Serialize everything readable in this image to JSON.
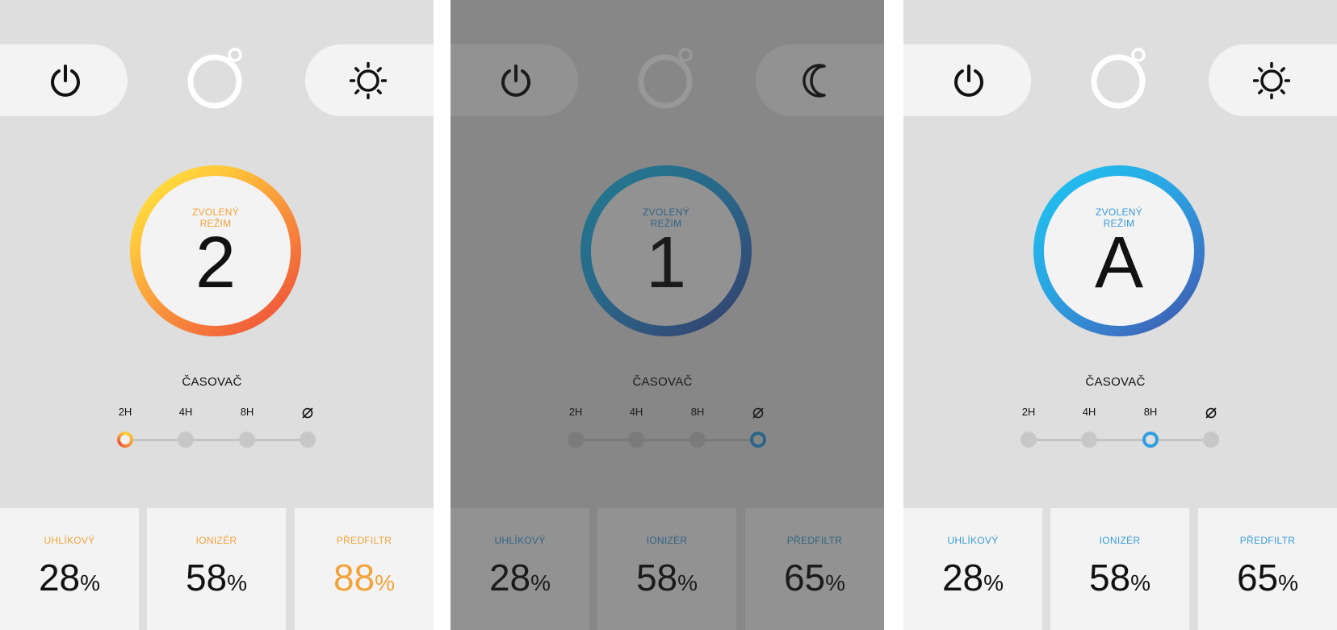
{
  "colors": {
    "warm_accent": "#f2a33a",
    "cool_accent": "#3a9bd9",
    "panel_bg": "#dedede",
    "card_bg": "#f3f3f3"
  },
  "panels": [
    {
      "left_icon": "power-icon",
      "right_icon": "sun-icon",
      "logo": "ring-logo",
      "mode_label_1": "ZVOLENÝ",
      "mode_label_2": "REŽIM",
      "mode_value": "2",
      "ring_theme": "warm",
      "timer_title": "ČASOVAČ",
      "timer_options": [
        "2H",
        "4H",
        "8H"
      ],
      "timer_off_icon": "timer-off-icon",
      "timer_selected_index": 0,
      "filters": [
        {
          "label": "UHLÍKOVÝ",
          "value": "28",
          "unit": "%"
        },
        {
          "label": "IONIZÉR",
          "value": "58",
          "unit": "%"
        },
        {
          "label": "PŘEDFILTR",
          "value": "88",
          "unit": "%",
          "highlight": true
        }
      ]
    },
    {
      "left_icon": "power-icon",
      "right_icon": "moon-icon",
      "logo": "ring-logo",
      "mode_label_1": "ZVOLENÝ",
      "mode_label_2": "REŽIM",
      "mode_value": "1",
      "ring_theme": "cool",
      "dimmed": true,
      "timer_title": "ČASOVAČ",
      "timer_options": [
        "2H",
        "4H",
        "8H"
      ],
      "timer_off_icon": "timer-off-icon",
      "timer_selected_index": 3,
      "filters": [
        {
          "label": "UHLÍKOVÝ",
          "value": "28",
          "unit": "%"
        },
        {
          "label": "IONIZÉR",
          "value": "58",
          "unit": "%"
        },
        {
          "label": "PŘEDFILTR",
          "value": "65",
          "unit": "%"
        }
      ]
    },
    {
      "left_icon": "power-icon",
      "right_icon": "sun-icon",
      "logo": "ring-logo",
      "mode_label_1": "ZVOLENÝ",
      "mode_label_2": "REŽIM",
      "mode_value": "A",
      "ring_theme": "cool",
      "timer_title": "ČASOVAČ",
      "timer_options": [
        "2H",
        "4H",
        "8H"
      ],
      "timer_off_icon": "timer-off-icon",
      "timer_selected_index": 2,
      "filters": [
        {
          "label": "UHLÍKOVÝ",
          "value": "28",
          "unit": "%"
        },
        {
          "label": "IONIZÉR",
          "value": "58",
          "unit": "%"
        },
        {
          "label": "PŘEDFILTR",
          "value": "65",
          "unit": "%"
        }
      ]
    }
  ]
}
